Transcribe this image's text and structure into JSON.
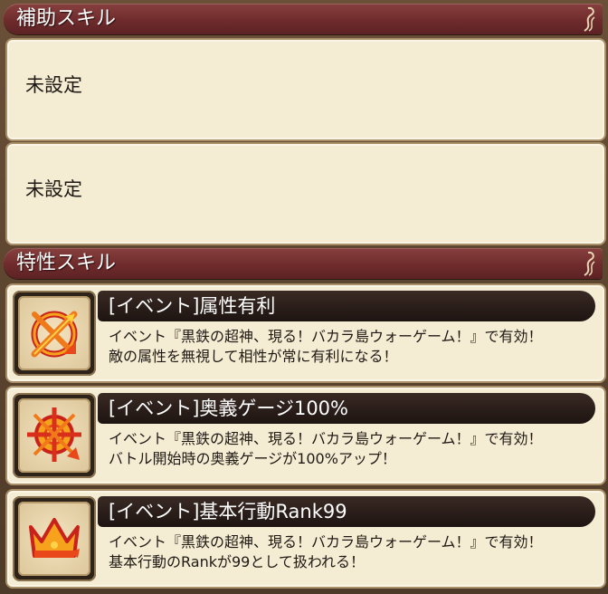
{
  "support_skills": {
    "header": "補助スキル",
    "slots": [
      {
        "label": "未設定"
      },
      {
        "label": "未設定"
      }
    ]
  },
  "trait_skills": {
    "header": "特性スキル",
    "items": [
      {
        "icon": "advantage-target-icon",
        "title": "[イベント]属性有利",
        "line1": "イベント『黒鉄の超神、現る！バカラ島ウォーゲーム！』で有効！",
        "line2": "敵の属性を無視して相性が常に有利になる！"
      },
      {
        "icon": "burst-gauge-icon",
        "title": "[イベント]奥義ゲージ100%",
        "line1": "イベント『黒鉄の超神、現る！バカラ島ウォーゲーム！』で有効！",
        "line2": "バトル開始時の奥義ゲージが100%アップ！"
      },
      {
        "icon": "crown-icon",
        "title": "[イベント]基本行動Rank99",
        "line1": "イベント『黒鉄の超神、現る！バカラ島ウォーゲーム！』で有効！",
        "line2": "基本行動のRankが99として扱われる！"
      }
    ]
  },
  "colors": {
    "header_red": "#6f2b2c",
    "panel": "#f5ecd4",
    "title_bar": "#1d1411",
    "icon_orange": "#f07a1a"
  }
}
